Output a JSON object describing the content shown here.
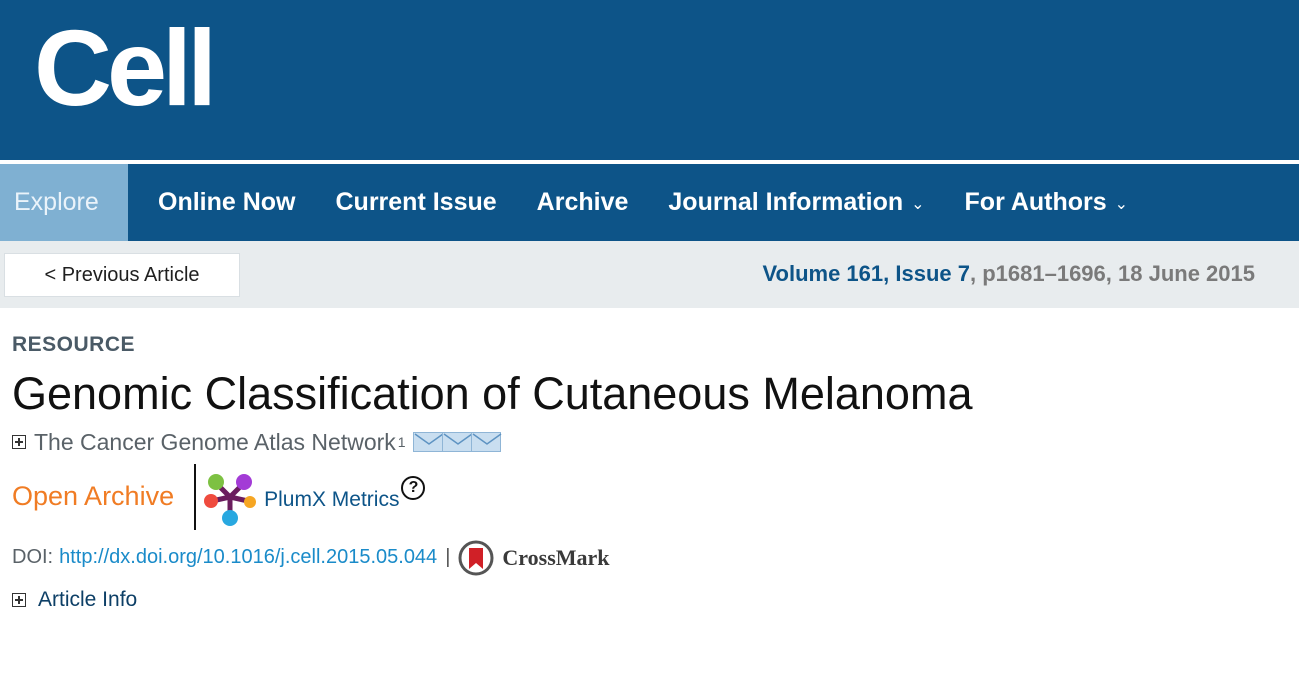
{
  "header": {
    "logo_text": "Cell",
    "brand_color": "#0d5488"
  },
  "nav": {
    "items": [
      {
        "label": "Explore",
        "active": true
      },
      {
        "label": "Online Now"
      },
      {
        "label": "Current Issue"
      },
      {
        "label": "Archive"
      },
      {
        "label": "Journal Information",
        "dropdown": true
      },
      {
        "label": "For Authors",
        "dropdown": true
      }
    ],
    "chevron": "⌄"
  },
  "subbar": {
    "prev_label": "< Previous Article",
    "volume": "Volume 161",
    "comma1": ",",
    "issue": "Issue 7",
    "rest": ", p1681–1696, 18 June 2015"
  },
  "article": {
    "section": "RESOURCE",
    "title": "Genomic Classification of Cutaneous Melanoma",
    "author": "The Cancer Genome Atlas Network",
    "author_sup": "1",
    "open_archive": "Open Archive",
    "plumx_label": "PlumX Metrics",
    "help_glyph": "?",
    "doi_prefix": "DOI:",
    "doi_link": "http://dx.doi.org/10.1016/j.cell.2015.05.044",
    "pipe": "|",
    "crossmark_label": "CrossMark",
    "article_info": "Article Info"
  },
  "icons": {
    "expand": "plus-box-icon",
    "mail": "mail-icon",
    "plumx": "plumx-icon",
    "crossmark": "crossmark-icon",
    "help": "help-icon"
  },
  "colors": {
    "open_archive": "#f07c24",
    "link": "#1a8bc9",
    "explore_bg": "#7fb0d2"
  }
}
